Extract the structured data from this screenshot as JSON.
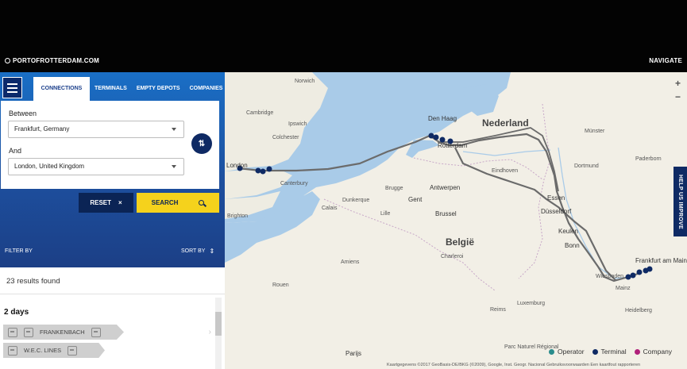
{
  "header": {
    "brand": "PORTOFROTTERDAM.COM",
    "navigate": "NAVIGATE"
  },
  "tabs": [
    {
      "label": "CONNECTIONS",
      "active": true
    },
    {
      "label": "TERMINALS"
    },
    {
      "label": "EMPTY DEPOTS"
    },
    {
      "label": "COMPANIES"
    }
  ],
  "form": {
    "between_label": "Between",
    "between_value": "Frankfurt, Germany",
    "and_label": "And",
    "and_value": "London, United Kingdom",
    "swap_icon": "⇅"
  },
  "buttons": {
    "reset": "RESET",
    "reset_icon": "×",
    "search": "SEARCH"
  },
  "filters": {
    "filter_by": "FILTER BY",
    "sort_by": "SORT BY",
    "sort_icon": "⇕"
  },
  "results": {
    "count_text": "23 results found",
    "group_title": "2 days",
    "routes": [
      {
        "operator": "FRANKENBACH",
        "mode": "train"
      },
      {
        "operator": "W.E.C. LINES",
        "mode": "ship"
      }
    ]
  },
  "map": {
    "zoom_in": "+",
    "zoom_out": "−",
    "help": "HELP US IMPROVE",
    "labels": {
      "nederland": "Nederland",
      "belgie": "België",
      "den_haag": "Den Haag",
      "rotterdam": "Rotterdam",
      "antwerpen": "Antwerpen",
      "brussel": "Brussel",
      "gent": "Gent",
      "brugge": "Brugge",
      "london": "London",
      "cambridge": "Cambridge",
      "norwich": "Norwich",
      "ipswich": "Ipswich",
      "colchester": "Colchester",
      "canterbury": "Canterbury",
      "brighton": "Brighton",
      "calais": "Calais",
      "dunkerque": "Dunkerque",
      "lille": "Lille",
      "amiens": "Amiens",
      "rouen": "Rouen",
      "parijs": "Parijs",
      "reims": "Reims",
      "charleroi": "Charleroi",
      "luxemburg": "Luxemburg",
      "eindhoven": "Eindhoven",
      "essen": "Essen",
      "dusseldorf": "Düsseldorf",
      "koln": "Keulen",
      "bonn": "Bonn",
      "dortmund": "Dortmund",
      "munster": "Münster",
      "paderborn": "Paderborn",
      "frankfurt": "Frankfurt am Main",
      "wiesbaden": "Wiesbaden",
      "mainz": "Mainz",
      "heidelberg": "Heidelberg",
      "parc": "Parc Naturel Régional"
    },
    "legend": [
      {
        "label": "Operator",
        "color": "#2a8c8c"
      },
      {
        "label": "Terminal",
        "color": "#0f2a64"
      },
      {
        "label": "Company",
        "color": "#b0207a"
      }
    ],
    "attribution": "Kaartgegevens ©2017 GeoBasis-DE/BKG (©2009), Google, Inst. Geogr. Nacional   Gebruiksvoorwaarden   Een kaartfout rapporteren"
  }
}
